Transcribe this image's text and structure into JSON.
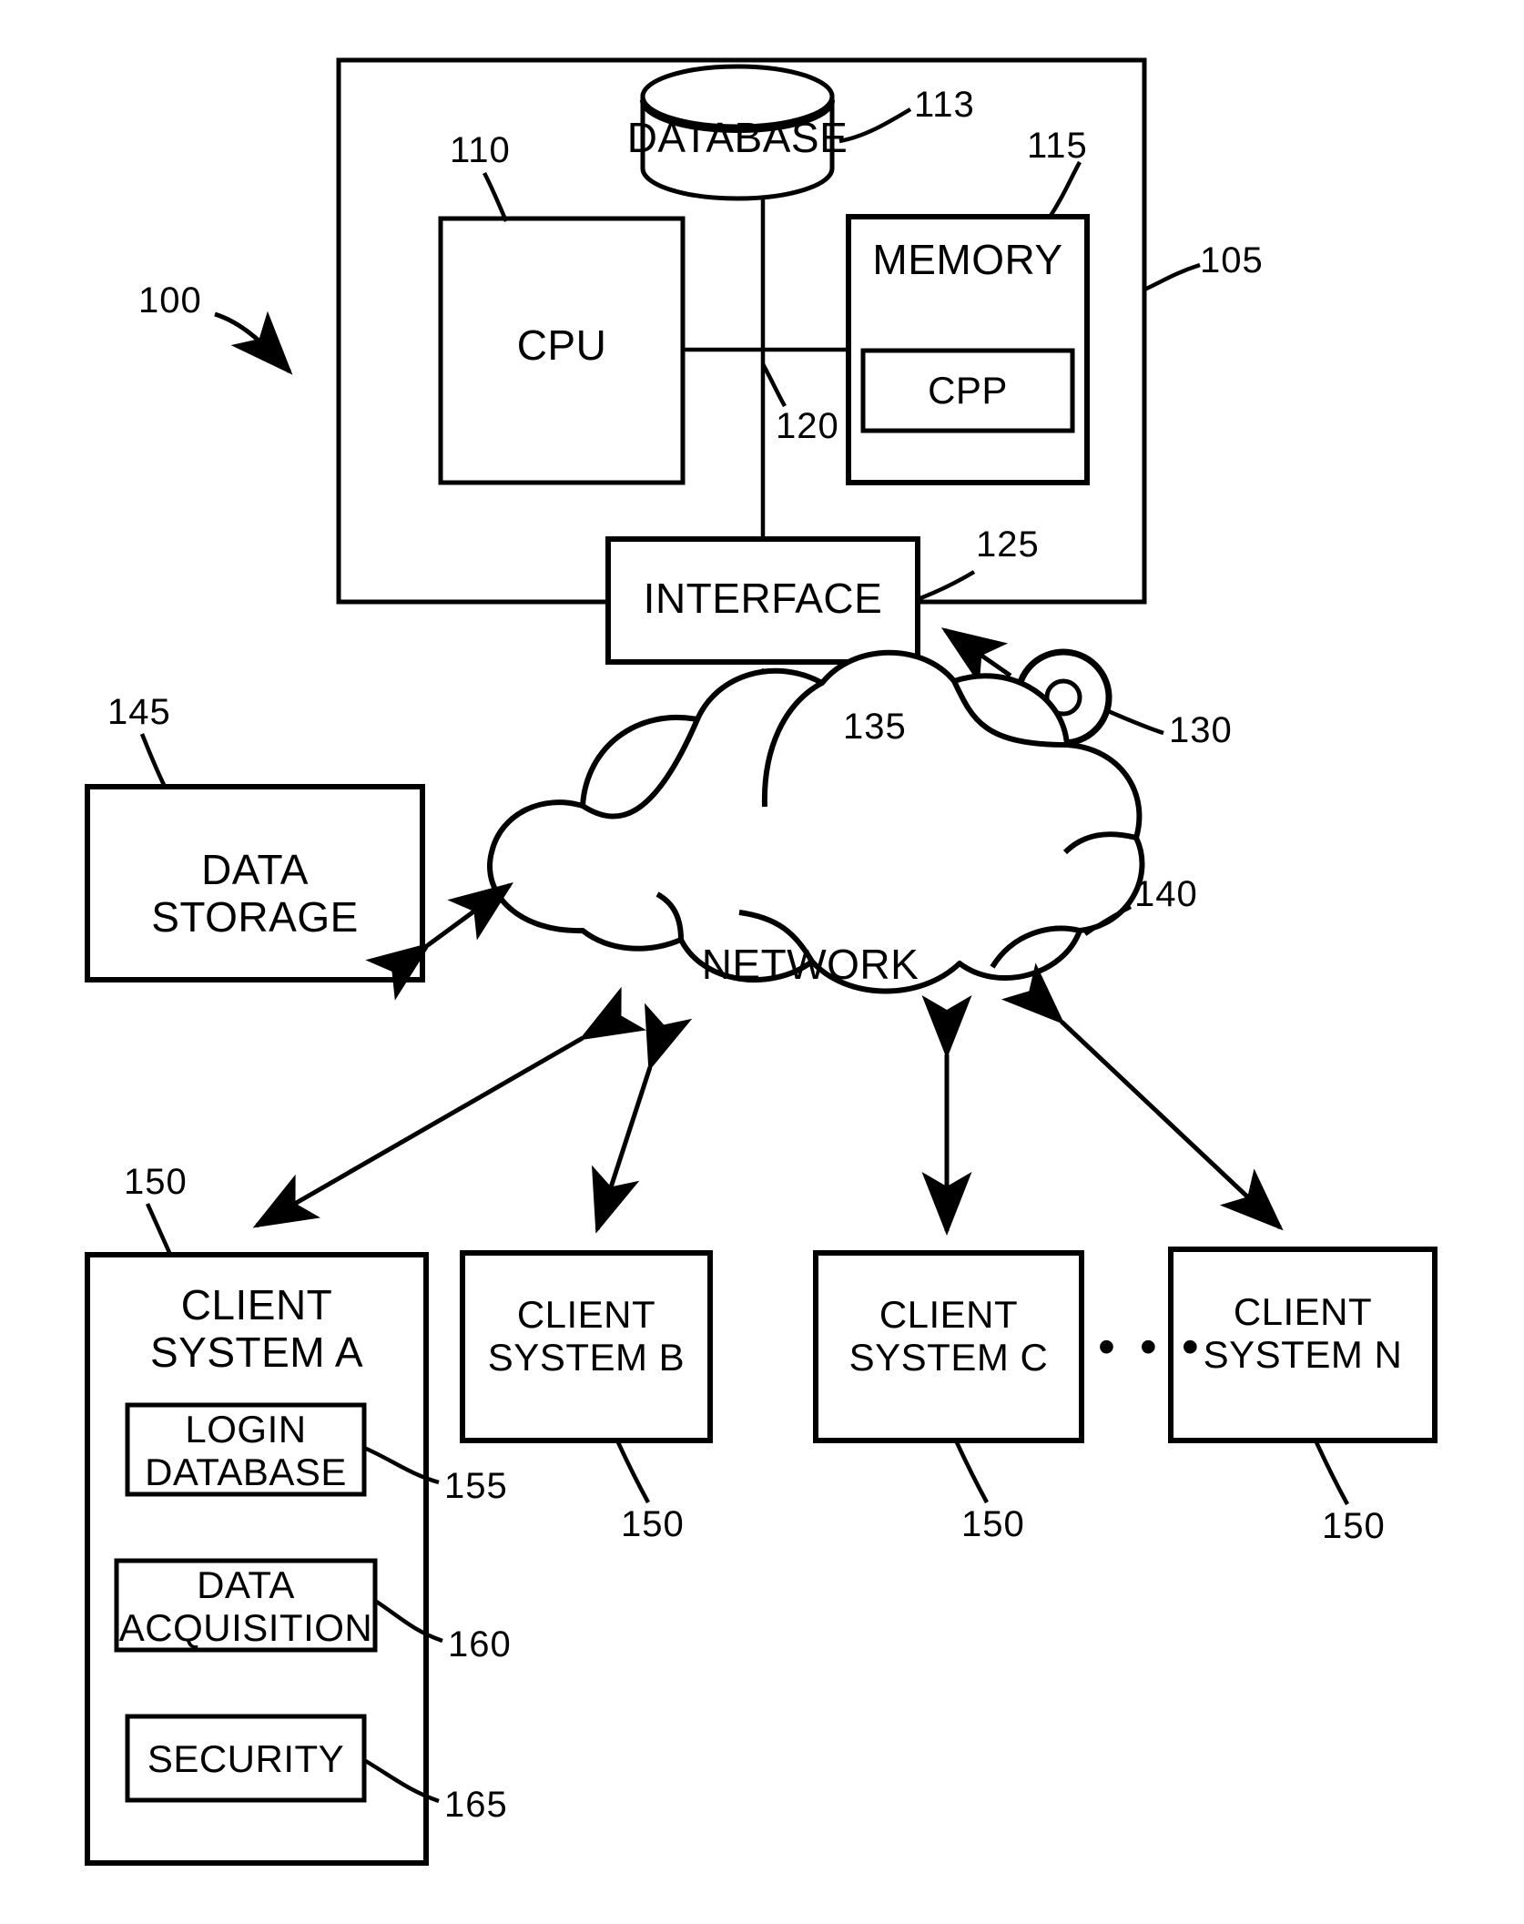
{
  "figure": {
    "title": "System architecture block diagram",
    "stroke_color": "#000000",
    "background_color": "#ffffff"
  },
  "nodes": {
    "server_enclosure": {
      "label": "",
      "ref": "105"
    },
    "database": {
      "label": "DATABASE",
      "ref": "113"
    },
    "cpu": {
      "label": "CPU",
      "ref": "110"
    },
    "memory": {
      "label": "MEMORY",
      "ref": "115"
    },
    "cpp": {
      "label": "CPP",
      "ref": ""
    },
    "bus": {
      "label": "",
      "ref": "120"
    },
    "interface": {
      "label": "INTERFACE",
      "ref": "125"
    },
    "media": {
      "label": "",
      "ref": "130"
    },
    "link_arrow": {
      "label": "",
      "ref": "135"
    },
    "network": {
      "label": "NETWORK",
      "ref": "140"
    },
    "data_storage": {
      "label": "DATA\nSTORAGE",
      "ref": "145"
    },
    "client_a": {
      "label": "CLIENT\nSYSTEM A",
      "ref": "150"
    },
    "client_b": {
      "label": "CLIENT\nSYSTEM B",
      "ref": "150"
    },
    "client_c": {
      "label": "CLIENT\nSYSTEM C",
      "ref": "150"
    },
    "client_n": {
      "label": "CLIENT\nSYSTEM N",
      "ref": "150"
    },
    "login_database": {
      "label": "LOGIN\nDATABASE",
      "ref": "155"
    },
    "data_acquisition": {
      "label": "DATA\nACQUISITION",
      "ref": "160"
    },
    "security": {
      "label": "SECURITY",
      "ref": "165"
    },
    "system_callout": {
      "label": "",
      "ref": "100"
    },
    "ellipsis": {
      "label": "• • •"
    }
  },
  "reference_numerals": [
    "100",
    "105",
    "110",
    "113",
    "115",
    "120",
    "125",
    "130",
    "135",
    "140",
    "145",
    "150",
    "155",
    "160",
    "165"
  ]
}
